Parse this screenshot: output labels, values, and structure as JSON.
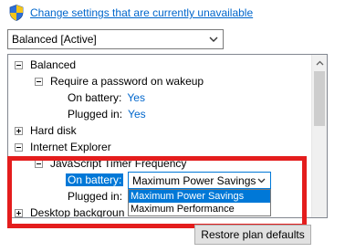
{
  "header": {
    "link_text": "Change settings that are currently unavailable",
    "shield_icon": "uac-shield-icon"
  },
  "plan_select": {
    "value": "Balanced [Active]"
  },
  "tree": {
    "balanced": "Balanced",
    "require_password": "Require a password on wakeup",
    "on_battery_label": "On battery:",
    "on_battery_value": "Yes",
    "plugged_in_label": "Plugged in:",
    "plugged_in_value": "Yes",
    "hard_disk": "Hard disk",
    "internet_explorer": "Internet Explorer",
    "js_timer": "JavaScript Timer Frequency",
    "js_on_battery_label": "On battery:",
    "js_plugged_in_label": "Plugged in:",
    "desktop_background": "Desktop backgroun"
  },
  "combo": {
    "selected": "Maximum Power Savings",
    "options": [
      "Maximum Power Savings",
      "Maximum Performance"
    ]
  },
  "buttons": {
    "restore": "Restore plan defaults"
  },
  "colors": {
    "link": "#0066cc",
    "highlight": "#0078d7",
    "annotation_box": "#e41d1d"
  }
}
